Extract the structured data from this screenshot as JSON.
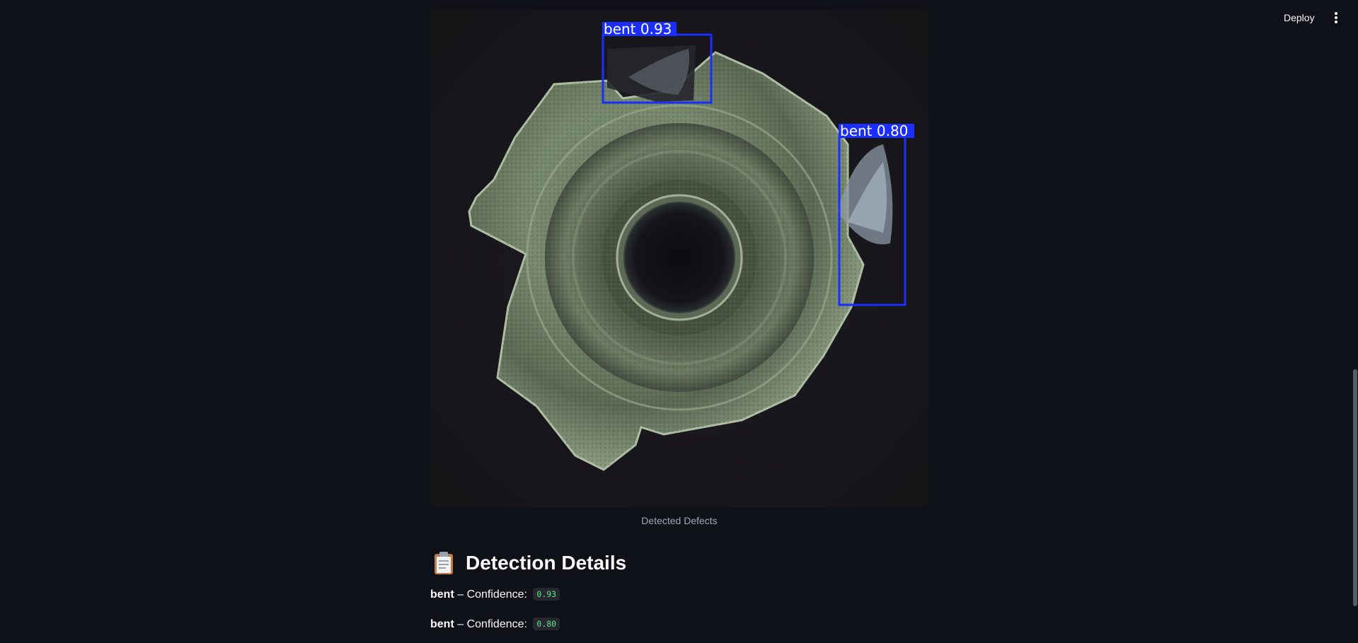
{
  "header": {
    "deploy_label": "Deploy",
    "menu_icon": "vertical-dots-icon"
  },
  "image": {
    "caption": "Detected Defects",
    "boxes": [
      {
        "label": "bent 0.93",
        "class": "bent",
        "confidence": 0.93
      },
      {
        "label": "bent 0.80",
        "class": "bent",
        "confidence": 0.8
      }
    ],
    "box_color": "#1a2fff"
  },
  "details": {
    "heading": "Detection Details",
    "heading_icon": "clipboard-icon",
    "items": [
      {
        "label": "bent",
        "separator": " – Confidence: ",
        "value": "0.93"
      },
      {
        "label": "bent",
        "separator": " – Confidence: ",
        "value": "0.80"
      }
    ]
  },
  "colors": {
    "background": "#0e1117",
    "text": "#fafafa",
    "code_text": "#5ce488",
    "code_bg": "#262730"
  }
}
